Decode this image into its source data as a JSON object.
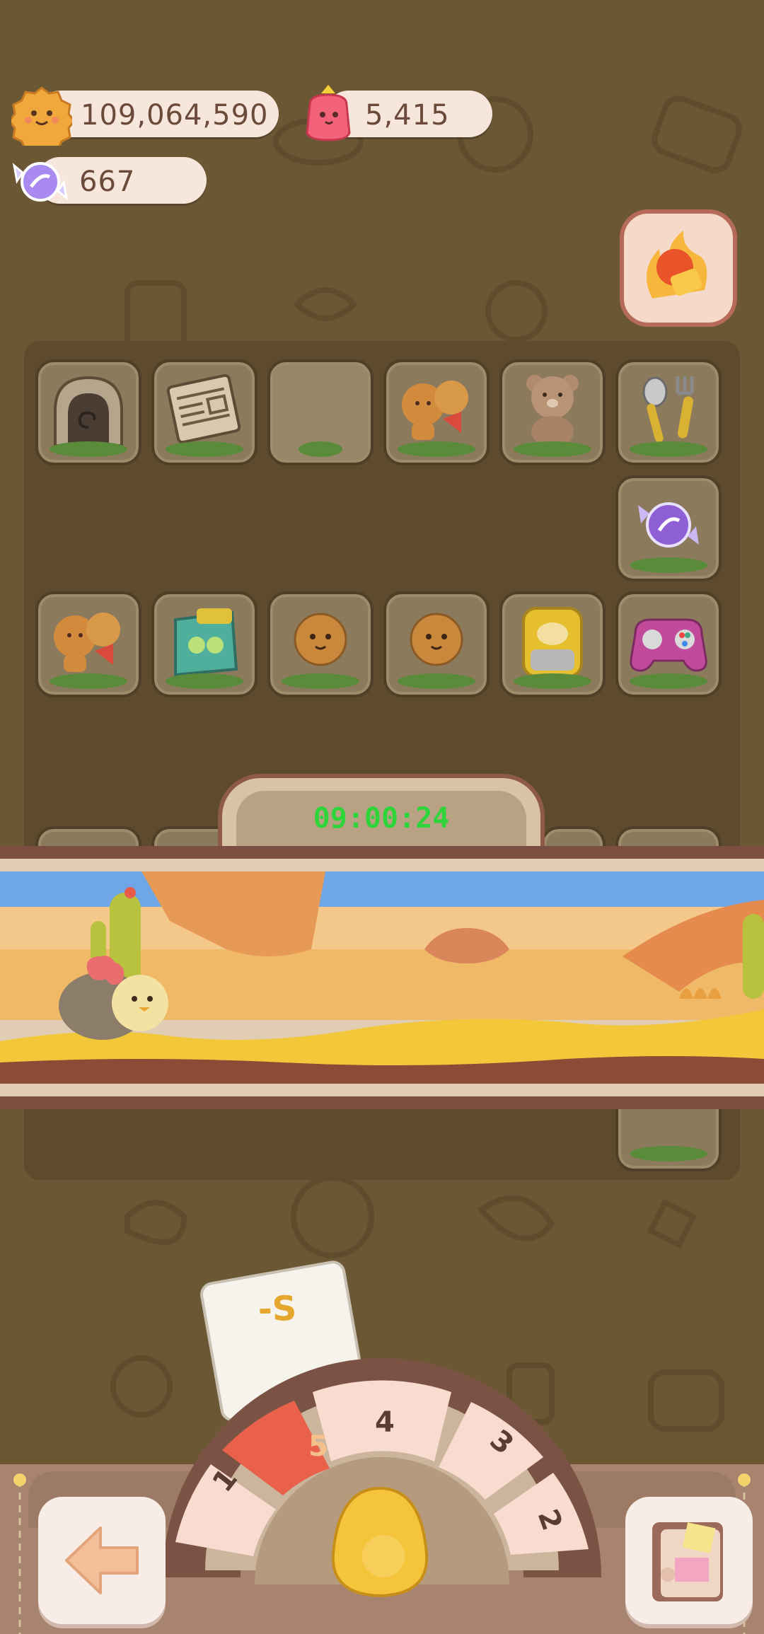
{
  "currencies": {
    "cookies": {
      "value": "109,064,590",
      "icon": "cookie-icon"
    },
    "jelly": {
      "value": "5,415",
      "icon": "jelly-icon"
    },
    "candy": {
      "value": "667",
      "icon": "candy-icon"
    }
  },
  "boost_button": {
    "icon": "fire-ticket-icon"
  },
  "board": {
    "row1": [
      "cave-portal",
      "newspaper",
      "empty",
      "cookie-pair-megaphone",
      "teddy-bear",
      "spoon-fork"
    ],
    "row2": [
      "",
      "",
      "",
      "",
      "",
      "purple-candy"
    ],
    "row3": [
      "cookie-pair-megaphone",
      "green-monster",
      "cookie",
      "cookie",
      "gold-pig-box",
      "gamepad"
    ]
  },
  "timer": {
    "value": "09:00:24"
  },
  "card": {
    "label": "-S"
  },
  "wheel": {
    "segments": [
      "1",
      "5",
      "4",
      "3",
      "2"
    ],
    "selected": "5"
  },
  "colors": {
    "background": "#6b5734",
    "timer_text": "#2fd33a",
    "selected_segment": "#e9614a"
  },
  "nav": {
    "back_icon": "back-arrow-icon",
    "book_icon": "recipe-book-icon",
    "egg_icon": "egg-icon"
  }
}
